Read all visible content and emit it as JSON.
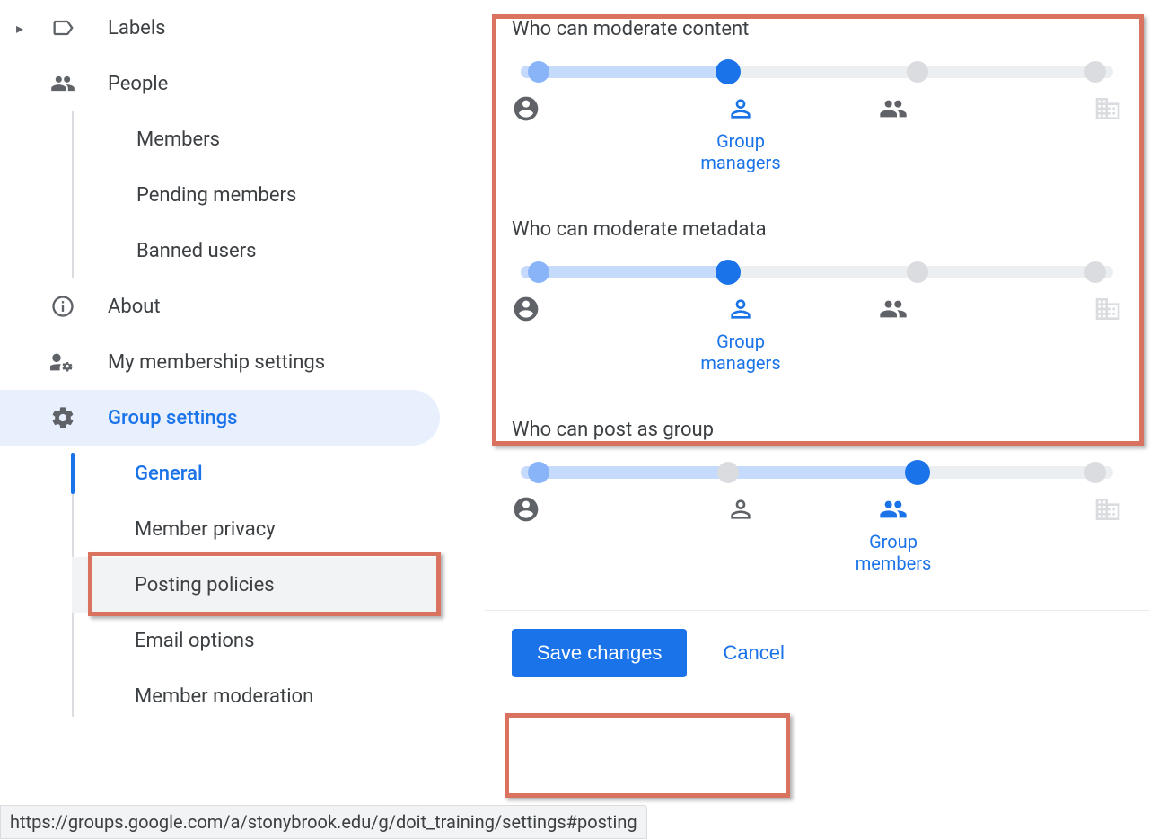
{
  "sidebar": {
    "labels": "Labels",
    "people": "People",
    "people_children": [
      "Members",
      "Pending members",
      "Banned users"
    ],
    "about": "About",
    "membership": "My membership settings",
    "group_settings": "Group settings",
    "settings_children": [
      "General",
      "Member privacy",
      "Posting policies",
      "Email options",
      "Member moderation"
    ]
  },
  "sections": [
    {
      "title": "Who can moderate content",
      "selected_index": 1,
      "selected_label": "Group\nmanagers"
    },
    {
      "title": "Who can moderate metadata",
      "selected_index": 1,
      "selected_label": "Group\nmanagers"
    },
    {
      "title": "Who can post as group",
      "selected_index": 2,
      "selected_label": "Group\nmembers"
    }
  ],
  "buttons": {
    "save": "Save changes",
    "cancel": "Cancel"
  },
  "status_url": "https://groups.google.com/a/stonybrook.edu/g/doit_training/settings#posting"
}
